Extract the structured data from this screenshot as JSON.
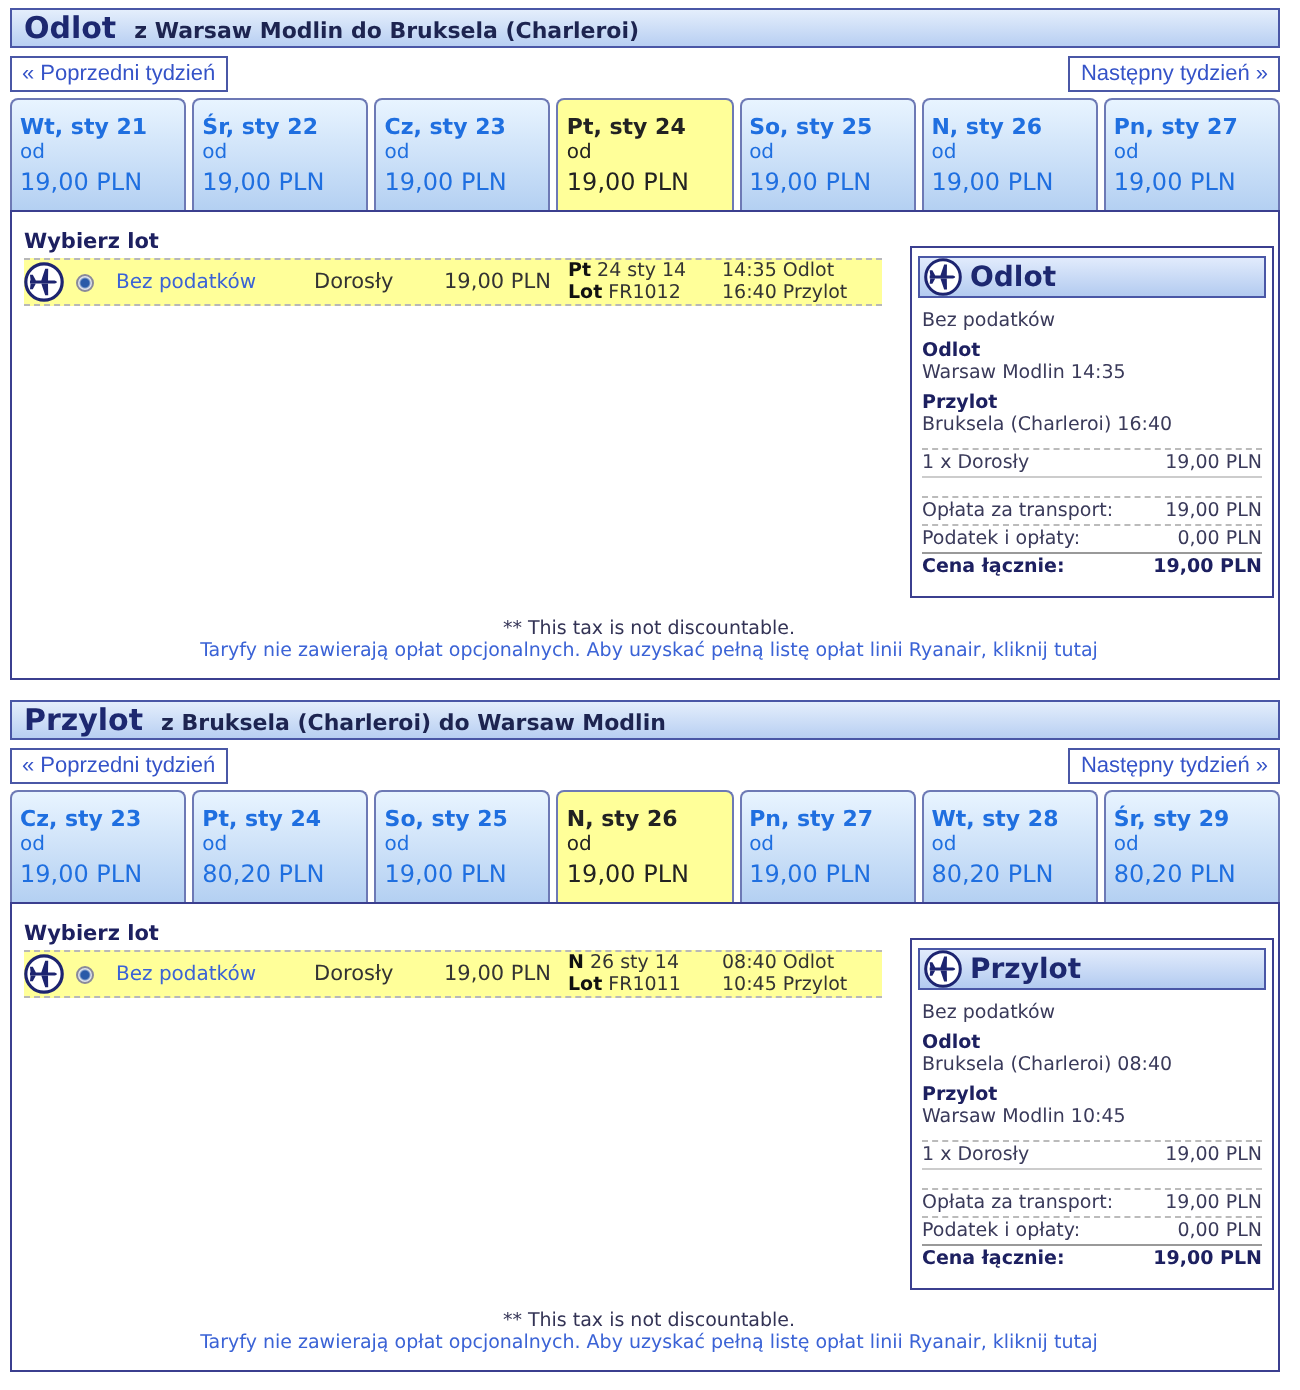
{
  "sections": [
    {
      "title": "Odlot",
      "route": "z Warsaw Modlin do Bruksela (Charleroi)",
      "prev_week": "« Poprzedni tydzień",
      "next_week": "Następny tydzień »",
      "days": [
        {
          "label": "Wt, sty 21",
          "from": "od",
          "price": "19,00 PLN",
          "selected": false
        },
        {
          "label": "Śr, sty 22",
          "from": "od",
          "price": "19,00 PLN",
          "selected": false
        },
        {
          "label": "Cz, sty 23",
          "from": "od",
          "price": "19,00 PLN",
          "selected": false
        },
        {
          "label": "Pt, sty 24",
          "from": "od",
          "price": "19,00 PLN",
          "selected": true
        },
        {
          "label": "So, sty 25",
          "from": "od",
          "price": "19,00 PLN",
          "selected": false
        },
        {
          "label": "N, sty 26",
          "from": "od",
          "price": "19,00 PLN",
          "selected": false
        },
        {
          "label": "Pn, sty 27",
          "from": "od",
          "price": "19,00 PLN",
          "selected": false
        }
      ],
      "select_heading": "Wybierz lot",
      "flights": [
        {
          "fare": "Bez podatków",
          "selected": true,
          "passenger": "Dorosły",
          "price": "19,00 PLN",
          "date": "**Pt** 24 sty 14",
          "flight": "**Lot** FR1012",
          "departure": "14:35 Odlot",
          "arrival": "16:40 Przylot"
        }
      ],
      "summary": {
        "title": "Odlot",
        "fare": "Bez podatków",
        "departure_heading": "Odlot",
        "departure": "Warsaw Modlin 14:35",
        "arrival_heading": "Przylot",
        "arrival": "Bruksela (Charleroi) 16:40",
        "passengers": [
          {
            "label": "1 x Dorosły",
            "amount": "19,00 PLN"
          }
        ],
        "charges": [
          {
            "label": "Opłata za transport:",
            "amount": "19,00 PLN"
          },
          {
            "label": "Podatek i opłaty:",
            "amount": "0,00 PLN"
          }
        ],
        "total": {
          "label": "Cena łącznie:",
          "amount": "19,00 PLN"
        }
      },
      "tax_note": "** This tax is not discountable.",
      "fees_link": "Taryfy nie zawierają opłat opcjonalnych. Aby uzyskać pełną listę opłat linii Ryanair, kliknij tutaj"
    },
    {
      "title": "Przylot",
      "route": "z Bruksela (Charleroi) do Warsaw Modlin",
      "prev_week": "« Poprzedni tydzień",
      "next_week": "Następny tydzień »",
      "days": [
        {
          "label": "Cz, sty 23",
          "from": "od",
          "price": "19,00 PLN",
          "selected": false
        },
        {
          "label": "Pt, sty 24",
          "from": "od",
          "price": "80,20 PLN",
          "selected": false
        },
        {
          "label": "So, sty 25",
          "from": "od",
          "price": "19,00 PLN",
          "selected": false
        },
        {
          "label": "N, sty 26",
          "from": "od",
          "price": "19,00 PLN",
          "selected": true
        },
        {
          "label": "Pn, sty 27",
          "from": "od",
          "price": "19,00 PLN",
          "selected": false
        },
        {
          "label": "Wt, sty 28",
          "from": "od",
          "price": "80,20 PLN",
          "selected": false
        },
        {
          "label": "Śr, sty 29",
          "from": "od",
          "price": "80,20 PLN",
          "selected": false
        }
      ],
      "select_heading": "Wybierz lot",
      "flights": [
        {
          "fare": "Bez podatków",
          "selected": true,
          "passenger": "Dorosły",
          "price": "19,00 PLN",
          "date": "**N** 26 sty 14",
          "flight": "**Lot** FR1011",
          "departure": "08:40 Odlot",
          "arrival": "10:45 Przylot"
        }
      ],
      "summary": {
        "title": "Przylot",
        "fare": "Bez podatków",
        "departure_heading": "Odlot",
        "departure": "Bruksela (Charleroi) 08:40",
        "arrival_heading": "Przylot",
        "arrival": "Warsaw Modlin 10:45",
        "passengers": [
          {
            "label": "1 x Dorosły",
            "amount": "19,00 PLN"
          }
        ],
        "charges": [
          {
            "label": "Opłata za transport:",
            "amount": "19,00 PLN"
          },
          {
            "label": "Podatek i opłaty:",
            "amount": "0,00 PLN"
          }
        ],
        "total": {
          "label": "Cena łącznie:",
          "amount": "19,00 PLN"
        }
      },
      "tax_note": "** This tax is not discountable.",
      "fees_link": "Taryfy nie zawierają opłat opcjonalnych. Aby uzyskać pełną listę opłat linii Ryanair, kliknij tutaj"
    }
  ]
}
